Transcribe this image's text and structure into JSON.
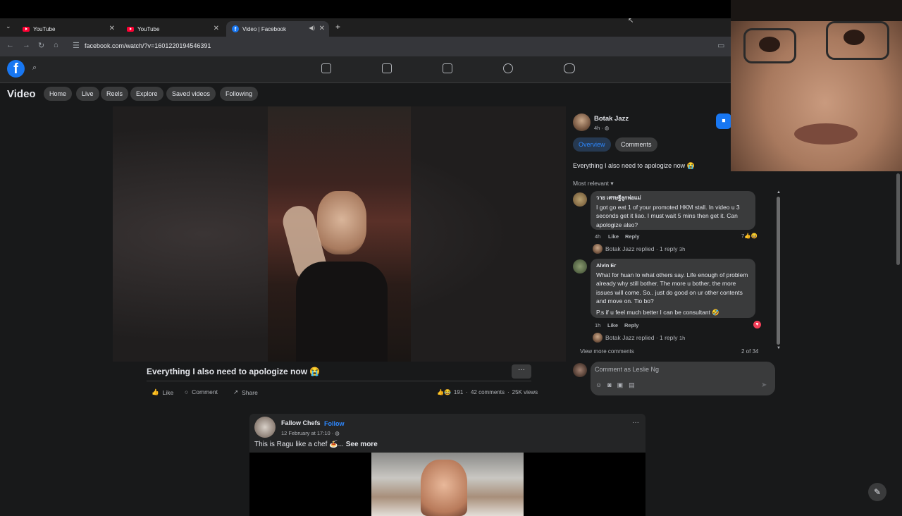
{
  "browser": {
    "tabs": [
      {
        "title": "YouTube",
        "type": "youtube"
      },
      {
        "title": "YouTube",
        "type": "youtube"
      },
      {
        "title": "Video | Facebook",
        "type": "facebook"
      }
    ],
    "new_tab": "+",
    "url": "facebook.com/watch/?v=1601220194546391"
  },
  "fb": {
    "logo": "f",
    "section_title": "Video",
    "subnav": [
      "Home",
      "Live",
      "Reels",
      "Explore",
      "Saved videos",
      "Following"
    ]
  },
  "post": {
    "title": "Everything I also need to apologize now 😭",
    "actions": {
      "like": "Like",
      "comment": "Comment",
      "share": "Share"
    },
    "reactions_count": "191",
    "comments_count": "42 comments",
    "views": "25K views",
    "more": "···"
  },
  "panel": {
    "author": "Botak Jazz",
    "author_time": "4h · ",
    "tabs": [
      "Overview",
      "Comments"
    ],
    "caption": "Everything I also need to apologize now 😭",
    "sort_label": "Most relevant",
    "comments": [
      {
        "name": "วาย เศรษฐีลูกพ่อแม่",
        "text": "I got go eat 1 of your promoted HKM stall. In video u 3 seconds get it liao. I must wait 5 mins then get it. Can apologize also?",
        "time": "4h",
        "like": "Like",
        "reply": "Reply",
        "reactions": "7",
        "replied": "Botak Jazz replied · 1 reply",
        "replied_time": "3h"
      },
      {
        "name": "Alvin Er",
        "text": "What for huan lo what others say. Life enough of problem already why still bother. The more u bother, the more issues will come. So.. just do good on ur other contents and move on. Tio bo?",
        "text2": "P.s if u feel much better I can be consultant 🤣",
        "time": "1h",
        "like": "Like",
        "reply": "Reply",
        "replied": "Botak Jazz replied · 1 reply",
        "replied_time": "1h"
      }
    ],
    "view_more": "View more comments",
    "count": "2 of 34",
    "comment_placeholder": "Comment as Leslie Ng"
  },
  "post2": {
    "author": "Fallow Chefs",
    "follow": "Follow",
    "date": "12 February at 17:10 · ",
    "text": "This is Ragu like a chef 🍝... ",
    "see_more": "See more",
    "more": "···"
  }
}
